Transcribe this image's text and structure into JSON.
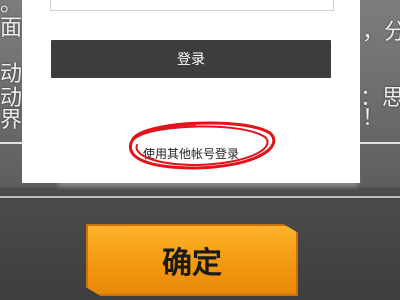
{
  "background": {
    "left_fragments": [
      "面",
      "动",
      "动",
      "界"
    ],
    "right_fragments": [
      "，分",
      "整：思",
      "！"
    ],
    "top_left_fragment": "。"
  },
  "dialog": {
    "login_label": "登录",
    "other_account_label": "使用其他帐号登录"
  },
  "confirm_label": "确定",
  "colors": {
    "login_button": "#3d3d3b",
    "confirm_button": "#f39a10",
    "annotation": "#e0141a"
  }
}
